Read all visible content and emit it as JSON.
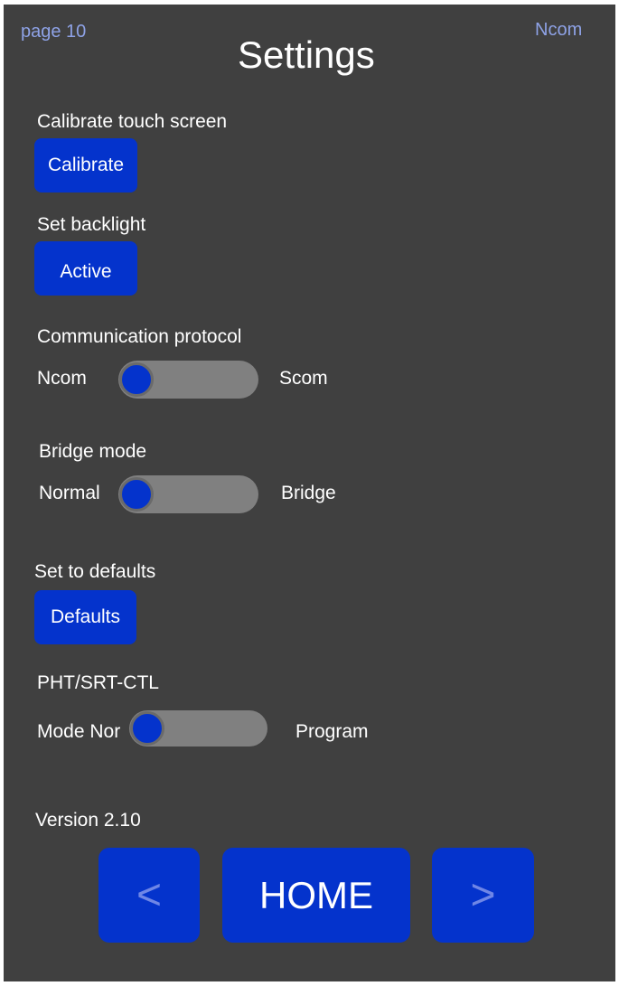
{
  "header": {
    "page_label": "page 10",
    "title": "Settings",
    "protocol_indicator": "Ncom"
  },
  "calibrate": {
    "label": "Calibrate touch screen",
    "button": "Calibrate"
  },
  "backlight": {
    "label": "Set backlight",
    "button": "Active"
  },
  "protocol": {
    "label": "Communication protocol",
    "left": "Ncom",
    "right": "Scom",
    "state": "Ncom"
  },
  "bridge": {
    "label": "Bridge mode",
    "left": "Normal",
    "right": "Bridge",
    "state": "Normal"
  },
  "defaults": {
    "label": "Set to defaults",
    "button": "Defaults"
  },
  "pht": {
    "label": "PHT/SRT-CTL",
    "left": "Mode Nor",
    "right": "Program",
    "state": "Mode Nor"
  },
  "version": "Version 2.10",
  "nav": {
    "prev": "<",
    "home": "HOME",
    "next": ">"
  },
  "colors": {
    "background": "#404040",
    "accent": "#0433cc",
    "toggle_track": "#808080",
    "corner_text": "#8ea2e6"
  }
}
